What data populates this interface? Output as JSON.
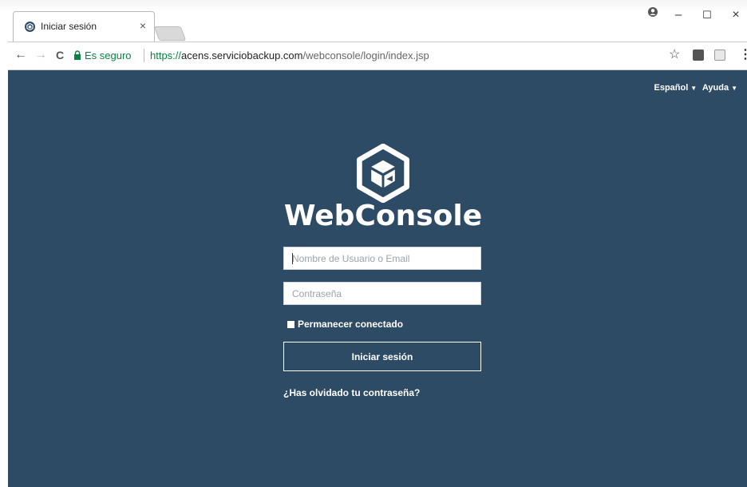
{
  "browser": {
    "tab_title": "Iniciar sesión",
    "tab_close": "×",
    "profile_icon": "account-circle-icon",
    "minimize": "–",
    "maximize": "☐",
    "close": "×",
    "back": "←",
    "forward": "→",
    "reload": "C",
    "secure_label": "Es seguro",
    "url_scheme": "https://",
    "url_host": "acens.serviciobackup.com",
    "url_path": "/webconsole/login/index.jsp",
    "star": "☆",
    "menu": "⋮"
  },
  "page": {
    "language": "Español",
    "help": "Ayuda",
    "brand": "WebConsole",
    "username_placeholder": "Nombre de Usuario o Email",
    "password_placeholder": "Contraseña",
    "remember_label": "Permanecer conectado",
    "login_button": "Iniciar sesión",
    "forgot_password": "¿Has olvidado tu contraseña?",
    "background_color": "#2e4b65"
  }
}
